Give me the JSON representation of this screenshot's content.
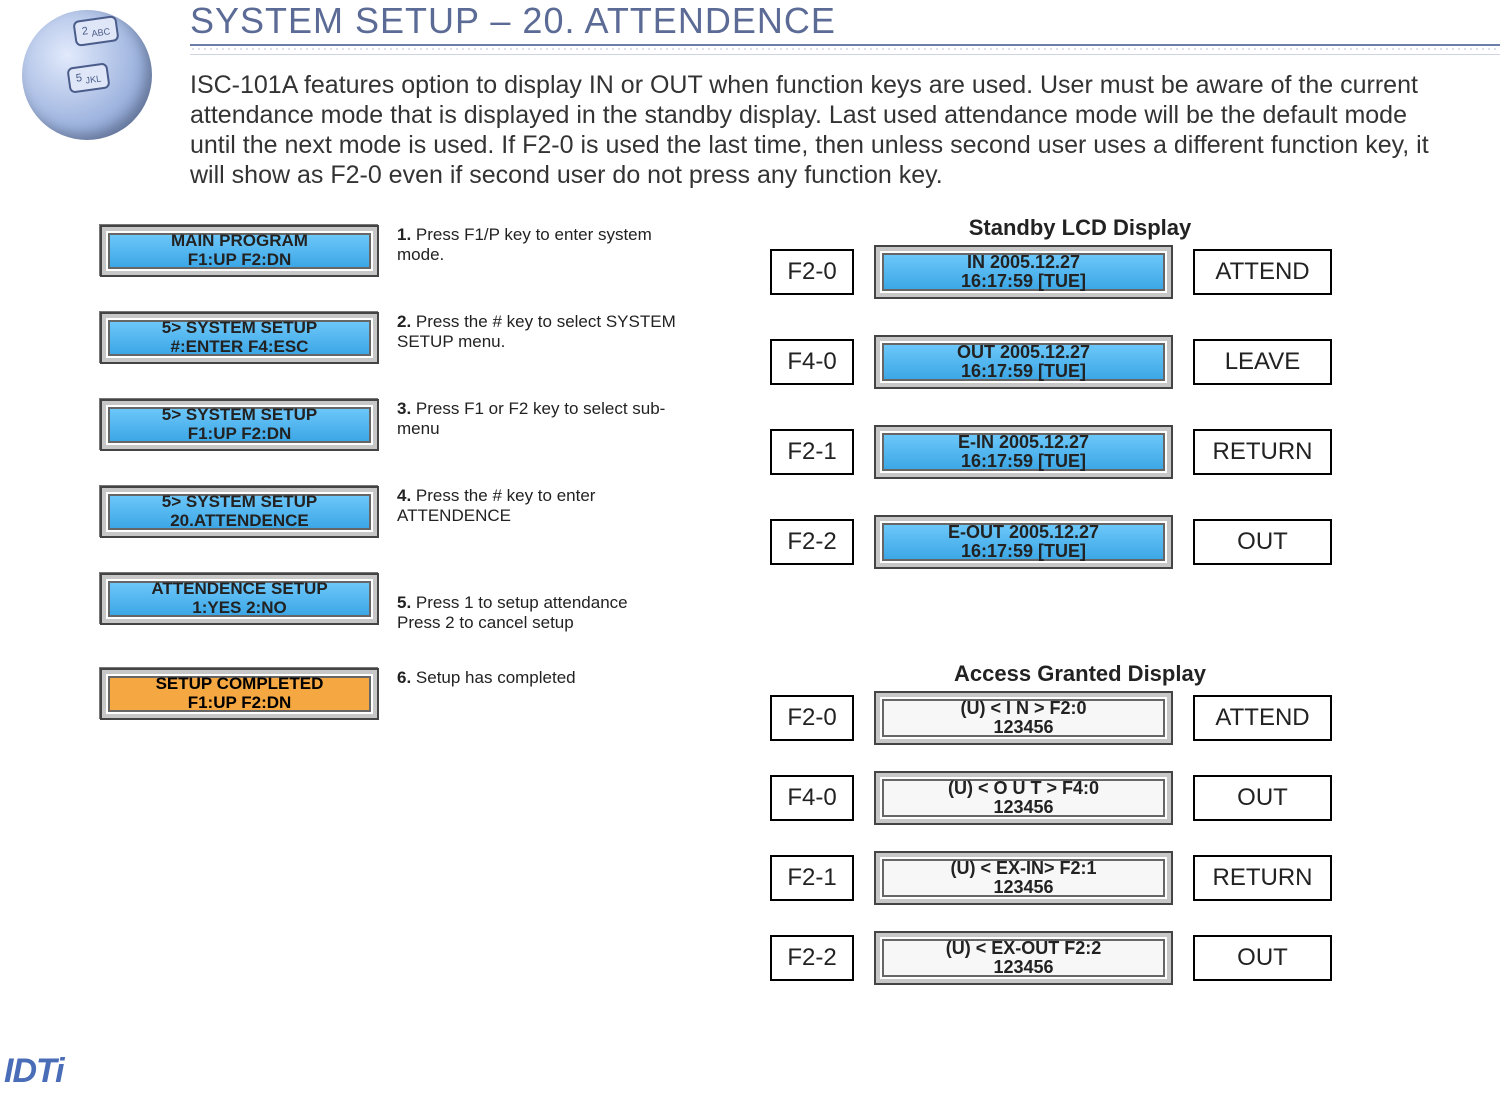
{
  "header": {
    "title": "SYSTEM SETUP – 20. ATTENDENCE"
  },
  "intro": "ISC-101A features option to display IN or OUT when function keys are used. User must be aware of the current attendance mode that is displayed in the standby display. Last used attendance mode will be the default mode until the next mode is used. If F2-0 is used the last time, then unless second user uses a different function key, it will show as F2-0 even if second user do not press any function key.",
  "steps": [
    {
      "lcd": {
        "line1": "MAIN PROGRAM",
        "line2": "F1:UP      F2:DN",
        "variant": "blue"
      },
      "num": "1.",
      "text": " Press F1/P key to enter system mode."
    },
    {
      "lcd": {
        "line1": "5> SYSTEM SETUP",
        "line2": "#:ENTER  F4:ESC",
        "variant": "blue"
      },
      "num": "2.",
      "text": " Press the # key to select  SYSTEM SETUP menu."
    },
    {
      "lcd": {
        "line1": "5> SYSTEM SETUP",
        "line2": "F1:UP    F2:DN",
        "variant": "blue"
      },
      "num": "3.",
      "text": " Press F1 or F2  key to select sub-menu"
    },
    {
      "lcd": {
        "line1": "5> SYSTEM SETUP",
        "line2": "20.ATTENDENCE",
        "variant": "blue"
      },
      "num": "4.",
      "text": " Press the # key to enter ATTENDENCE"
    },
    {
      "lcd": {
        "line1": "ATTENDENCE SETUP",
        "line2": "1:YES    2:NO",
        "variant": "blue"
      },
      "num": "5.",
      "text": " Press 1 to setup attendance\nPress 2 to cancel setup"
    },
    {
      "lcd": {
        "line1": "SETUP COMPLETED",
        "line2": "F1:UP    F2:DN",
        "variant": "orange"
      },
      "num": "6.",
      "text": " Setup has completed"
    }
  ],
  "standby": {
    "title": "Standby LCD Display",
    "rows": [
      {
        "key": "F2-0",
        "lcd": {
          "line1": "IN    2005.12.27",
          "line2": "16:17:59 [TUE]",
          "variant": "blue"
        },
        "label": "ATTEND"
      },
      {
        "key": "F4-0",
        "lcd": {
          "line1": "OUT    2005.12.27",
          "line2": "16:17:59 [TUE]",
          "variant": "blue"
        },
        "label": "LEAVE"
      },
      {
        "key": "F2-1",
        "lcd": {
          "line1": "E-IN    2005.12.27",
          "line2": "16:17:59 [TUE]",
          "variant": "blue"
        },
        "label": "RETURN"
      },
      {
        "key": "F2-2",
        "lcd": {
          "line1": "E-OUT   2005.12.27",
          "line2": "16:17:59 [TUE]",
          "variant": "blue"
        },
        "label": "OUT"
      }
    ]
  },
  "access": {
    "title": "Access Granted Display",
    "rows": [
      {
        "key": "F2-0",
        "lcd": {
          "line1": "(U)  < I  N >  F2:0",
          "line2": "123456",
          "variant": "white"
        },
        "label": "ATTEND"
      },
      {
        "key": "F4-0",
        "lcd": {
          "line1": "(U)  < O U T >  F4:0",
          "line2": "123456",
          "variant": "white"
        },
        "label": "OUT"
      },
      {
        "key": "F2-1",
        "lcd": {
          "line1": "(U)  < EX-IN>  F2:1",
          "line2": "123456",
          "variant": "white"
        },
        "label": "RETURN"
      },
      {
        "key": "F2-2",
        "lcd": {
          "line1": "(U)  < EX-OUT  F2:2",
          "line2": "123456",
          "variant": "white"
        },
        "label": "OUT"
      }
    ]
  },
  "footer": {
    "logo": "IDTi"
  }
}
